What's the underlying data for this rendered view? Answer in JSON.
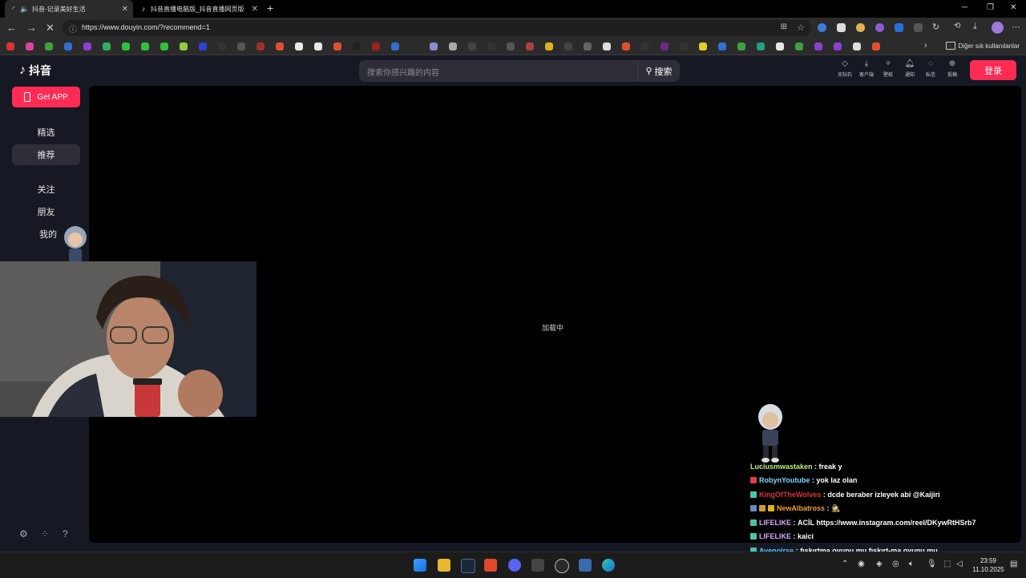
{
  "browser": {
    "tabs": [
      {
        "title": "抖音-记录美好生活",
        "active": true
      },
      {
        "title": "抖音直播电脑版_抖音直播网页版",
        "active": false
      }
    ],
    "url": "https://www.douyin.com/?recommend=1",
    "bookmarks_folder": "Diğer sık kullanılanlar"
  },
  "header": {
    "logo_text": "抖音",
    "search_placeholder": "搜索你感兴趣的内容",
    "search_button": "搜索",
    "icons": [
      {
        "label": "充钻石",
        "icon": "diamond-icon"
      },
      {
        "label": "客户端",
        "icon": "download-icon"
      },
      {
        "label": "壁纸",
        "icon": "wallpaper-icon"
      },
      {
        "label": "通知",
        "icon": "bell-icon"
      },
      {
        "label": "私信",
        "icon": "message-icon"
      },
      {
        "label": "投稿",
        "icon": "upload-icon"
      }
    ],
    "login": "登录"
  },
  "sidebar": {
    "get_app": "Get APP",
    "items": [
      {
        "label": "精选",
        "selected": false
      },
      {
        "label": "推荐",
        "selected": true
      },
      {
        "label": "关注",
        "selected": false
      },
      {
        "label": "朋友",
        "selected": false
      },
      {
        "label": "我的",
        "selected": false
      }
    ]
  },
  "player": {
    "loading_text": "加载中"
  },
  "chat": [
    {
      "user": "Luciusmwastaken",
      "color": "#b9f27c",
      "badge": "",
      "msg": "freak y"
    },
    {
      "user": "RobynYoutube",
      "color": "#7fd8ff",
      "badge": "#e23b4a",
      "msg": "yok laz olan"
    },
    {
      "user": "KingOfTheWolves",
      "color": "#e0303c",
      "badge": "#4fc3a8",
      "msg": "dcde beraber izleyek abi @Kaijiri"
    },
    {
      "user": "NewAlbatross",
      "color": "#f0a032",
      "badge": "#c8a030",
      "msg": "🕵"
    },
    {
      "user": "LIFELIKE",
      "color": "#d9a7ff",
      "badge": "#4fc3a8",
      "msg": "ACİL https://www.instagram.com/reel/DKywRtHSrb7"
    },
    {
      "user": "LIFELIKE",
      "color": "#d9a7ff",
      "badge": "#4fc3a8",
      "msg": "kaici"
    },
    {
      "user": "Avenoirse",
      "color": "#4fc3ff",
      "badge": "#4fc3a8",
      "msg": "fışkırtma oyunu mu fışkırt-ma oyunu mu"
    }
  ],
  "taskbar": {
    "time": "23:59",
    "date": "11.10.2025"
  },
  "colors": {
    "accent": "#fe2c55",
    "page_bg": "#161823",
    "player_bg": "#000000"
  }
}
